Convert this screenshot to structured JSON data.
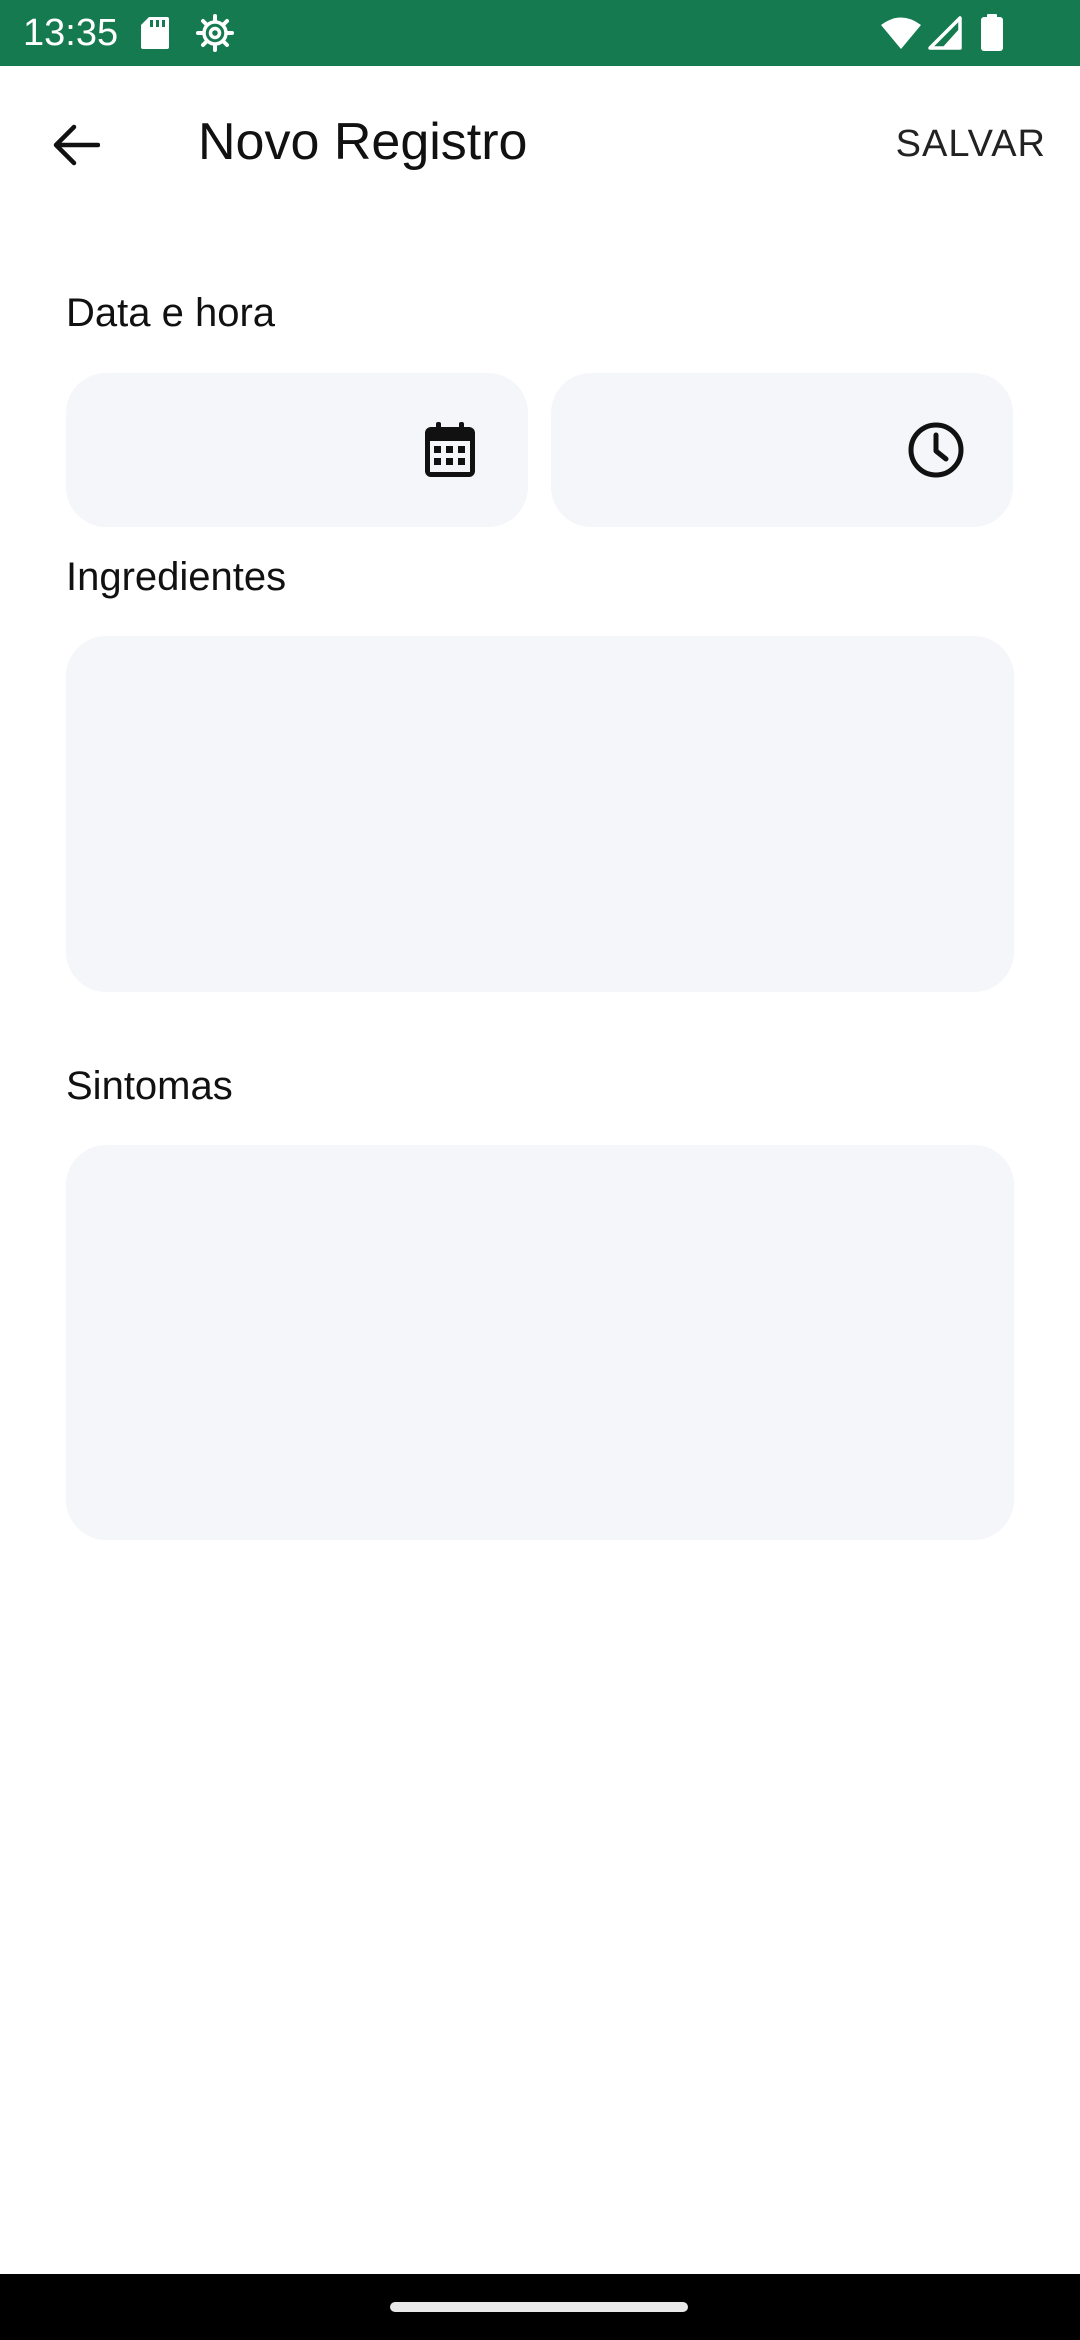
{
  "status_bar": {
    "time": "13:35",
    "icons": [
      "sd-card-icon",
      "settings-gear-icon",
      "wifi-icon",
      "signal-icon",
      "battery-icon"
    ],
    "background_color": "#157a50"
  },
  "toolbar": {
    "title": "Novo Registro",
    "save_label": "SALVAR",
    "back_icon": "arrow-back-icon"
  },
  "form": {
    "datetime": {
      "label": "Data e hora",
      "date_value": "",
      "time_value": "",
      "date_icon": "calendar-icon",
      "time_icon": "clock-icon"
    },
    "ingredients": {
      "label": "Ingredientes",
      "value": ""
    },
    "symptoms": {
      "label": "Sintomas",
      "value": ""
    }
  },
  "colors": {
    "input_background": "#f5f6fa",
    "status_bar": "#157a50"
  }
}
